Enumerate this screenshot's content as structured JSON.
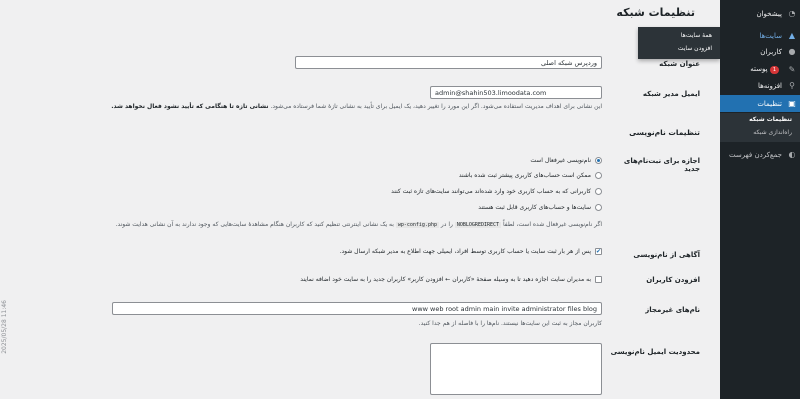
{
  "sidebar": {
    "items": [
      {
        "label": "پیشخوان",
        "icon": "dashboard-icon"
      },
      {
        "label": "سایت‌ها",
        "icon": "sites-icon"
      },
      {
        "label": "کاربران",
        "icon": "users-icon"
      },
      {
        "label": "پوسته",
        "icon": "themes-icon",
        "badge": "1"
      },
      {
        "label": "افزونه‌ها",
        "icon": "plugins-icon"
      },
      {
        "label": "تنظیمات",
        "icon": "settings-icon"
      },
      {
        "label": "جمع‌کردن فهرست",
        "icon": "collapse-icon"
      }
    ],
    "submenu": [
      "تنظیمات شبکه",
      "راه‌اندازی شبکه"
    ]
  },
  "flyout": {
    "items": [
      "همهٔ سایت‌ها",
      "افزودن سایت"
    ]
  },
  "page_title": "تنظیمات شبکه",
  "fields": {
    "network_title": {
      "label": "عنوان شبکه",
      "value": "وردپرس شبکه اصلی"
    },
    "admin_email": {
      "label": "ایمیل مدیر شبکه",
      "value": "admin@shahin503.limoodata.com",
      "desc_normal": "این نشانی برای اهداف مدیریت استفاده می‌شود. اگر این مورد را تغییر دهید، یک ایمیل برای تأیید به نشانی تازهٔ شما فرستاده می‌شود.",
      "desc_bold": "نشانی تازه تا هنگامی که تأیید نشود فعال نخواهد شد."
    },
    "registration_section": "تنظیمات نام‌نویسی",
    "allow_registrations": {
      "label": "اجازه برای نبت‌نام‌های جدید",
      "options": [
        "نام‌نویسی غیرفعال است",
        "ممکن است حساب‌های کاربری پیشتر ثبت شده باشند",
        "کاربرانی که به حساب کاربری خود وارد شده‌اند می‌توانند سایت‌های تازه ثبت کنند",
        "سایت‌ها و حساب‌های کاربری قابل ثبت هستند"
      ],
      "selected": 0,
      "note_part1": "اگر نام‌نویسی غیرفعال شده است، لطفاً",
      "note_code1": "NOBLOGREDIRECT",
      "note_part2": "را در",
      "note_code2": "wp-config.php",
      "note_part3": "به یک نشانی اینترنتی تنظیم کنید که کاربران هنگام مشاهدهٔ سایت‌هایی که وجود ندارند به آن نشانی هدایت شوند."
    },
    "registration_notification": {
      "label": "آگاهی از نام‌نویسی",
      "text": "پس از هر بار ثبت سایت یا حساب کاربری توسط افراد، ایمیلی جهت اطلاع به مدیر شبکه ارسال شود.",
      "checked": true
    },
    "add_new_users": {
      "label": "افزودن کاربران",
      "text": "به مدیران سایت اجازه دهید تا به وسیله صفحهٔ «کاربران ← افزودن کاربر» کاربران جدید را به سایت خود اضافه نمایند",
      "checked": false
    },
    "banned_names": {
      "label": "نام‌های غیرمجاز",
      "value": "www web root admin main invite administrator files blog",
      "desc": "کاربران مجاز به ثبت این سایت‌ها نیستند. نام‌ها را با فاصله از هم جدا کنید."
    },
    "limited_email": {
      "label": "محدودیت ایمیل نام‌نویسی",
      "value": ""
    }
  },
  "timestamp": "2025/05/28 11:46"
}
